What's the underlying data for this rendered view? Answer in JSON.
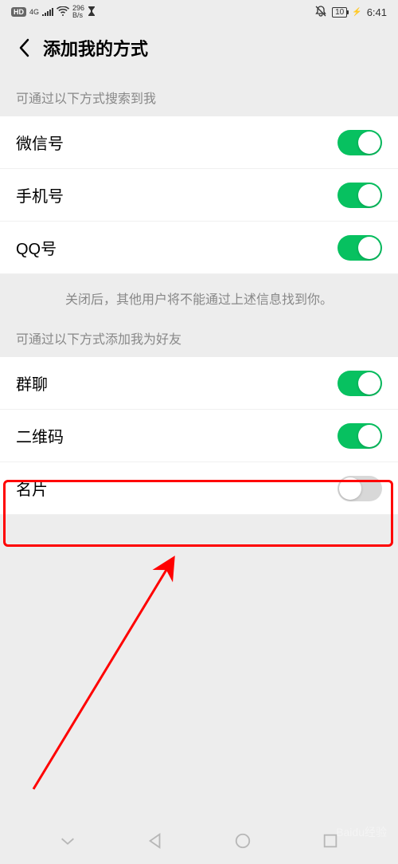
{
  "status": {
    "hd": "HD",
    "network_label": "4G",
    "speed": "296",
    "speed_unit": "B/s",
    "battery": "10",
    "time": "6:41"
  },
  "nav": {
    "title": "添加我的方式"
  },
  "section1": {
    "header": "可通过以下方式搜索到我",
    "items": [
      {
        "label": "微信号",
        "on": true
      },
      {
        "label": "手机号",
        "on": true
      },
      {
        "label": "QQ号",
        "on": true
      }
    ],
    "hint": "关闭后，其他用户将不能通过上述信息找到你。"
  },
  "section2": {
    "header": "可通过以下方式添加我为好友",
    "items": [
      {
        "label": "群聊",
        "on": true
      },
      {
        "label": "二维码",
        "on": true
      },
      {
        "label": "名片",
        "on": false
      }
    ]
  },
  "watermark": "Baidu经验"
}
